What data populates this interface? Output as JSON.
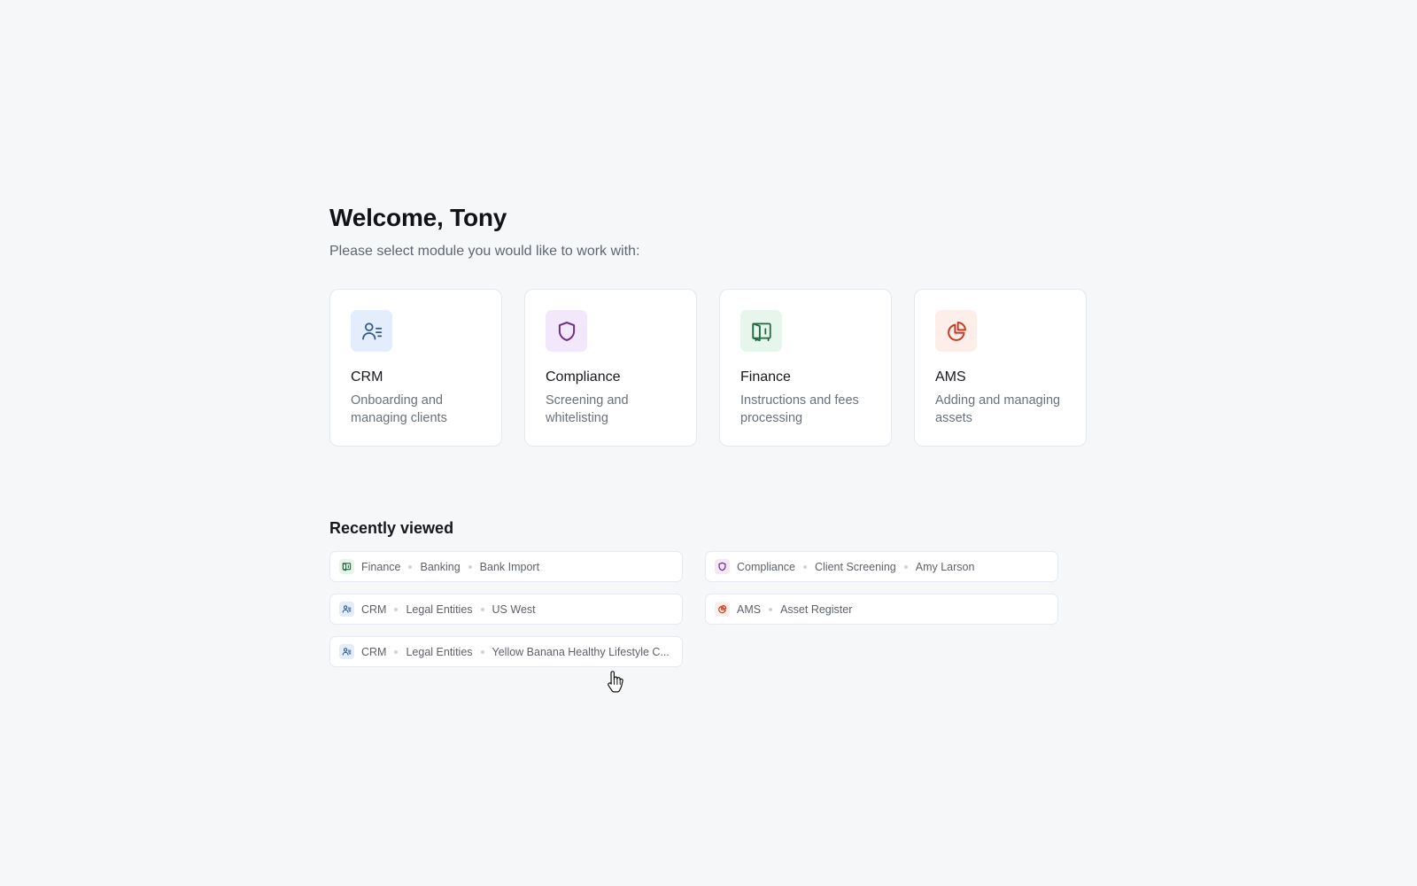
{
  "welcome": {
    "title": "Welcome, Tony",
    "subtitle": "Please select module you would like to work with:"
  },
  "modules": [
    {
      "title": "CRM",
      "description": "Onboarding and managing clients",
      "icon": "users-list-icon",
      "icon_color": "#2f5a8a",
      "icon_bg": "#e3edfb"
    },
    {
      "title": "Compliance",
      "description": "Screening and whitelisting",
      "icon": "shield-icon",
      "icon_color": "#6b2a8c",
      "icon_bg": "#f3e8fb"
    },
    {
      "title": "Finance",
      "description": "Instructions and fees processing",
      "icon": "safe-icon",
      "icon_color": "#1e6b3f",
      "icon_bg": "#e6f6ec"
    },
    {
      "title": "AMS",
      "description": "Adding and managing assets",
      "icon": "pie-chart-icon",
      "icon_color": "#c63a24",
      "icon_bg": "#fdeeea"
    }
  ],
  "recent": {
    "title": "Recently viewed",
    "items": [
      {
        "crumbs": [
          "Finance",
          "Banking",
          "Bank Import"
        ],
        "icon": "safe-icon"
      },
      {
        "crumbs": [
          "Compliance",
          "Client Screening",
          "Amy Larson"
        ],
        "icon": "shield-icon"
      },
      {
        "crumbs": [
          "CRM",
          "Legal Entities",
          "US West"
        ],
        "icon": "users-list-icon"
      },
      {
        "crumbs": [
          "AMS",
          "Asset Register"
        ],
        "icon": "pie-chart-icon"
      },
      {
        "crumbs": [
          "CRM",
          "Legal Entities",
          "Yellow Banana Healthy Lifestyle C..."
        ],
        "icon": "users-list-icon"
      }
    ]
  }
}
